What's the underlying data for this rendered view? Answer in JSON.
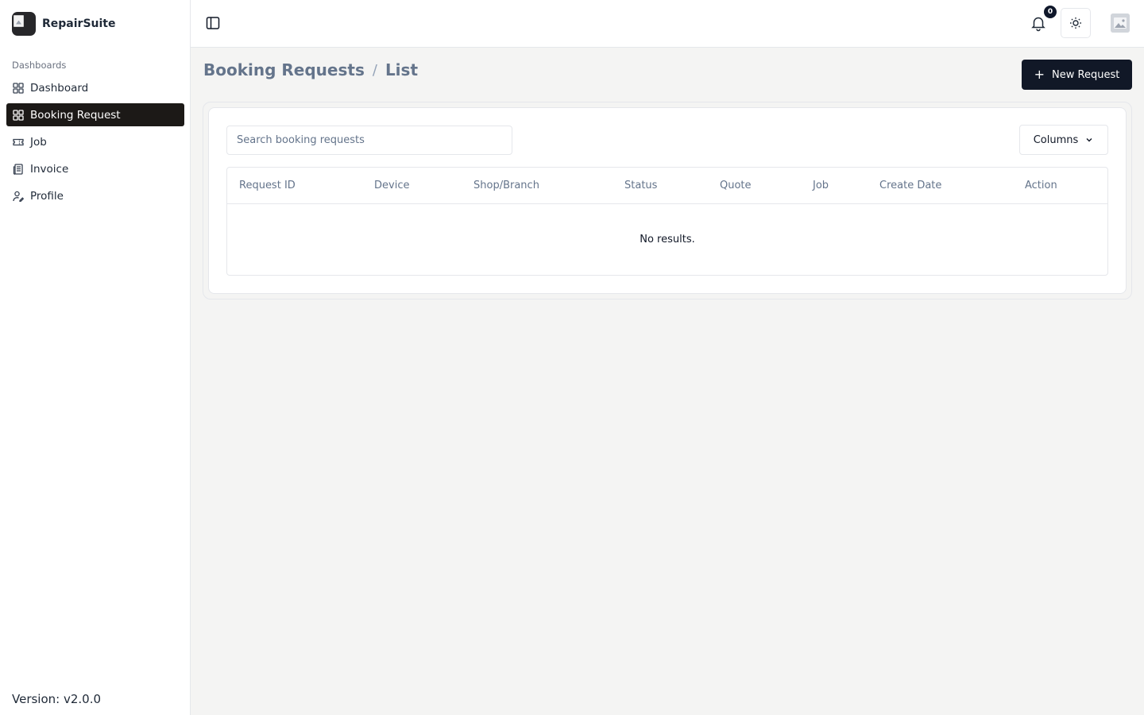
{
  "app": {
    "name": "RepairSuite"
  },
  "sidebar": {
    "section_label": "Dashboards",
    "items": [
      {
        "label": "Dashboard",
        "icon": "grid-icon",
        "active": false
      },
      {
        "label": "Booking Request",
        "icon": "grid-icon",
        "active": true
      },
      {
        "label": "Job",
        "icon": "ticket-icon",
        "active": false
      },
      {
        "label": "Invoice",
        "icon": "receipt-icon",
        "active": false
      },
      {
        "label": "Profile",
        "icon": "user-pen-icon",
        "active": false
      }
    ],
    "version": "Version: v2.0.0"
  },
  "header": {
    "notification_count": "0"
  },
  "page": {
    "breadcrumb": {
      "root": "Booking Requests",
      "separator": "/",
      "current": "List"
    },
    "new_button_label": "New Request",
    "search_placeholder": "Search booking requests",
    "columns_button_label": "Columns",
    "table": {
      "headers": [
        "Request ID",
        "Device",
        "Shop/Branch",
        "Status",
        "Quote",
        "Job",
        "Create Date",
        "Action"
      ],
      "empty_message": "No results."
    }
  },
  "colors": {
    "accent": "#111827",
    "sidebar_active": "#1c1917",
    "page_bg": "#f4f4f3",
    "muted_text": "#64748b"
  }
}
